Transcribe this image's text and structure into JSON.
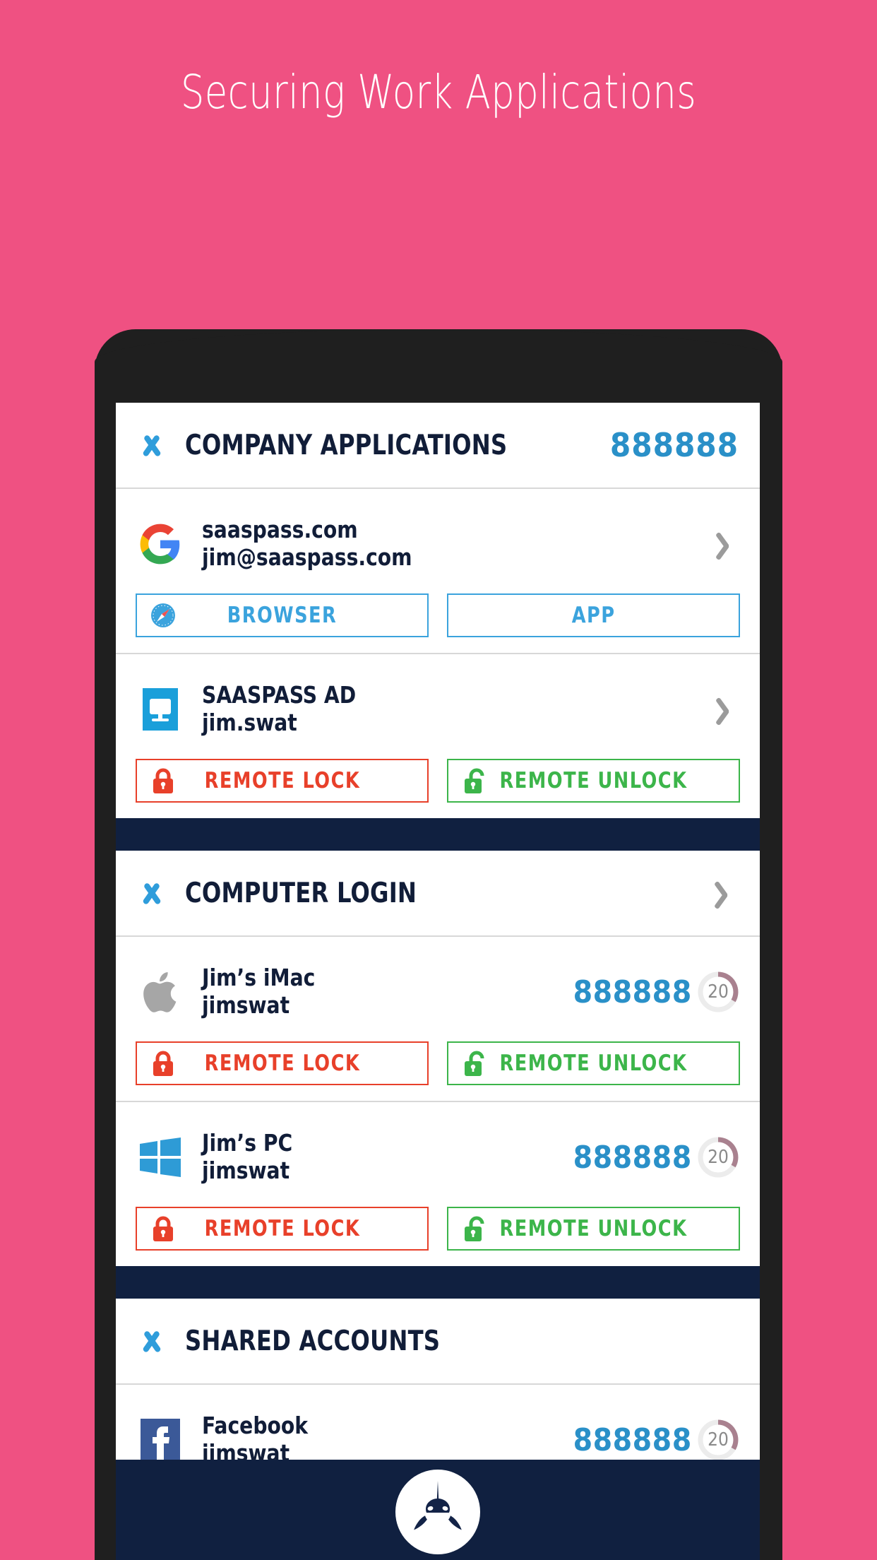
{
  "hero": {
    "title": "Securing Work Applications"
  },
  "colors": {
    "background_pink": "#ef5182",
    "phone_bezel": "#1f1f1f",
    "accent_blue": "#2a90c8",
    "button_blue": "#3ba3dd",
    "lock_red": "#e8402a",
    "unlock_green": "#3cb54a",
    "navy": "#102040",
    "ring_arc": "#a9818f"
  },
  "sections": [
    {
      "id": "company-applications",
      "title": "COMPANY APPLICATIONS",
      "code": "888888",
      "has_chevron": false,
      "rows": [
        {
          "icon": "google-icon",
          "name": "saaspass.com",
          "username": "jim@saaspass.com",
          "chevron": true,
          "code": null,
          "countdown": null,
          "buttons": [
            {
              "label": "BROWSER",
              "style": "blue",
              "icon": "safari-compass-icon"
            },
            {
              "label": "APP",
              "style": "blue",
              "icon": null
            }
          ]
        },
        {
          "icon": "desktop-monitor-icon",
          "name": "SAASPASS AD",
          "username": "jim.swat",
          "chevron": true,
          "code": null,
          "countdown": null,
          "buttons": [
            {
              "label": "REMOTE LOCK",
              "style": "red",
              "icon": "lock-closed-icon"
            },
            {
              "label": "REMOTE UNLOCK",
              "style": "green",
              "icon": "lock-open-icon"
            }
          ]
        }
      ]
    },
    {
      "id": "computer-login",
      "title": "COMPUTER LOGIN",
      "code": null,
      "has_chevron": true,
      "rows": [
        {
          "icon": "apple-icon",
          "name": "Jim’s iMac",
          "username": "jimswat",
          "chevron": false,
          "code": "888888",
          "countdown": "20",
          "buttons": [
            {
              "label": "REMOTE LOCK",
              "style": "red",
              "icon": "lock-closed-icon"
            },
            {
              "label": "REMOTE UNLOCK",
              "style": "green",
              "icon": "lock-open-icon"
            }
          ]
        },
        {
          "icon": "windows-icon",
          "name": "Jim’s PC",
          "username": "jimswat",
          "chevron": false,
          "code": "888888",
          "countdown": "20",
          "buttons": [
            {
              "label": "REMOTE LOCK",
              "style": "red",
              "icon": "lock-closed-icon"
            },
            {
              "label": "REMOTE UNLOCK",
              "style": "green",
              "icon": "lock-open-icon"
            }
          ]
        }
      ]
    },
    {
      "id": "shared-accounts",
      "title": "SHARED ACCOUNTS",
      "code": null,
      "has_chevron": false,
      "rows": [
        {
          "icon": "facebook-icon",
          "name": "Facebook",
          "username": "jimswat",
          "chevron": false,
          "code": "888888",
          "countdown": "20",
          "buttons": []
        }
      ]
    }
  ],
  "bottom_nav": {
    "logo": "saaspass-orca-logo"
  }
}
